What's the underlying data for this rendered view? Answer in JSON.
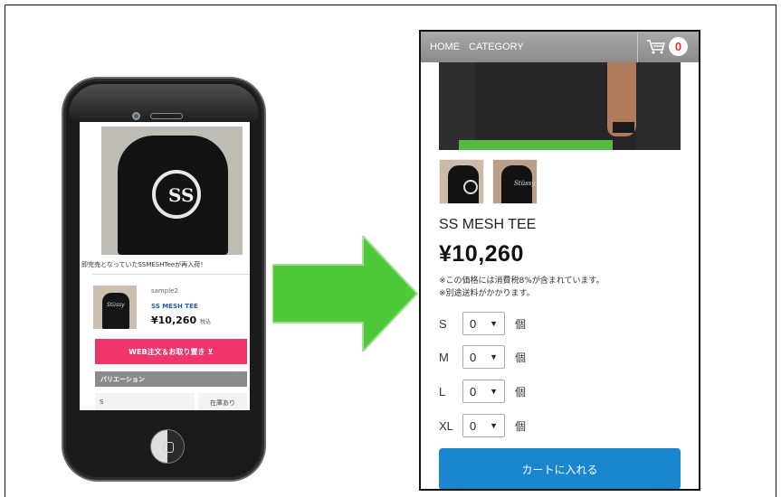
{
  "phone": {
    "caption": "即完売となっていたSSMESHTeeが再入荷！",
    "sample_label": "sample2",
    "product_name": "SS MESH TEE",
    "price": "¥10,260",
    "tax_label": "税込",
    "web_order_button": "WEB注文＆お取り置き ⊻",
    "variation_header": "バリエーション",
    "variation_size": "S",
    "variation_stock": "在庫あり"
  },
  "panel": {
    "nav": {
      "home": "HOME",
      "category": "CATEGORY",
      "cart_count": "0",
      "cart_icon": "cart-icon"
    },
    "product_title": "SS MESH TEE",
    "price": "¥10,260",
    "note_tax": "※この価格には消費税8%が含まれています。",
    "note_shipping": "※別途送料がかかります。",
    "sizes": [
      {
        "label": "S",
        "qty": "0"
      },
      {
        "label": "M",
        "qty": "0"
      },
      {
        "label": "L",
        "qty": "0"
      },
      {
        "label": "XL",
        "qty": "0"
      }
    ],
    "unit": "個",
    "add_to_cart": "カートに入れる"
  },
  "colors": {
    "arrow": "#4ec93a",
    "web_button": "#f0356a",
    "cart_button": "#1a86cd",
    "nav_bar": "#999999",
    "cart_badge": "#e0312d"
  }
}
